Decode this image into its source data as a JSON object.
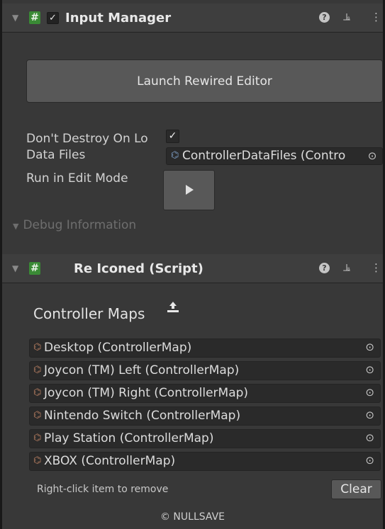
{
  "input_manager": {
    "title": "Input Manager",
    "enabled_check": "✓",
    "launch_button": "Launch Rewired Editor",
    "dont_destroy_label": "Don't Destroy On Lo",
    "dont_destroy_checked": true,
    "dont_destroy_check": "✓",
    "data_files_label": "Data Files",
    "data_files_value": "ControllerDataFiles (Contro",
    "run_in_edit_label": "Run in Edit Mode",
    "debug_label": "Debug Information"
  },
  "reiconed": {
    "title": "Re Iconed (Script)",
    "section_title": "Controller Maps",
    "maps": [
      "Desktop (ControllerMap)",
      "Joycon (TM) Left (ControllerMap)",
      "Joycon (TM) Right (ControllerMap)",
      "Nintendo Switch (ControllerMap)",
      "Play Station (ControllerMap)",
      "XBOX (ControllerMap)"
    ],
    "hint": "Right-click item to remove",
    "clear_button": "Clear",
    "footer": "© NULLSAVE"
  },
  "icons": {
    "fold": "▼",
    "script": "#",
    "help": "?",
    "settings": "⫡",
    "menu": "⋮",
    "object_picker": "⊙",
    "asset": "⌬",
    "upload": "upload-icon"
  },
  "colors": {
    "background": "#383838",
    "header": "#3e3e3e",
    "button": "#585858",
    "field": "#2a2a2a",
    "script_icon": "#3a8a35"
  }
}
